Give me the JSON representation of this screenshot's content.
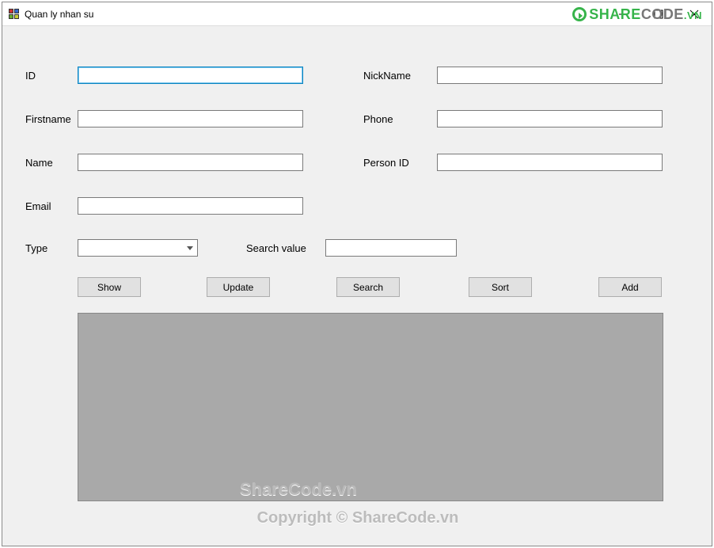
{
  "window": {
    "title": "Quan ly nhan su"
  },
  "brand": {
    "part1": "SHARE",
    "part2": "CODE",
    "part3": ".VN"
  },
  "form": {
    "left": {
      "id": {
        "label": "ID",
        "value": ""
      },
      "firstname": {
        "label": "Firstname",
        "value": ""
      },
      "name": {
        "label": "Name",
        "value": ""
      },
      "email": {
        "label": "Email",
        "value": ""
      }
    },
    "right": {
      "nickname": {
        "label": "NickName",
        "value": ""
      },
      "phone": {
        "label": "Phone",
        "value": ""
      },
      "personid": {
        "label": "Person ID",
        "value": ""
      }
    },
    "type": {
      "label": "Type",
      "value": ""
    },
    "searchvalue": {
      "label": "Search value",
      "value": ""
    }
  },
  "buttons": {
    "show": "Show",
    "update": "Update",
    "search": "Search",
    "sort": "Sort",
    "add": "Add"
  },
  "watermarks": {
    "grid": "ShareCode.vn",
    "footer": "Copyright © ShareCode.vn"
  }
}
